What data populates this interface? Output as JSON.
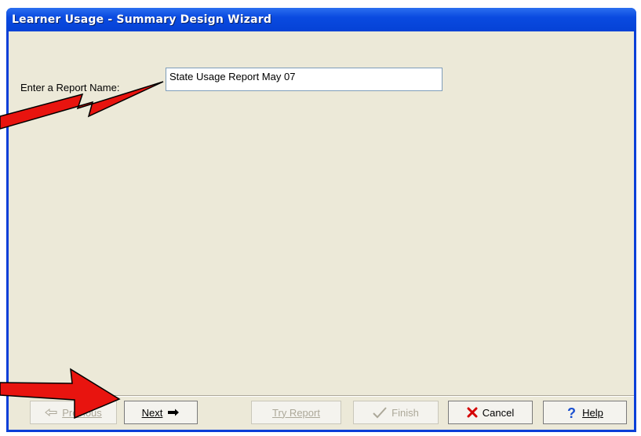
{
  "window": {
    "title": "Learner Usage - Summary Design Wizard"
  },
  "form": {
    "label": "Enter a Report Name:",
    "report_name_value": "State Usage Report May 07"
  },
  "buttons": {
    "previous": {
      "label": "Previous",
      "icon": "left-arrow-icon",
      "enabled": false
    },
    "next": {
      "label": "Next",
      "icon": "right-arrow-icon",
      "enabled": true
    },
    "try_report": {
      "label": "Try Report",
      "enabled": false
    },
    "finish": {
      "label": "Finish",
      "icon": "checkmark-icon",
      "enabled": false
    },
    "cancel": {
      "label": "Cancel",
      "icon": "red-x-icon",
      "enabled": true
    },
    "help": {
      "label": "Help",
      "icon": "question-mark-icon",
      "enabled": true
    }
  },
  "annotations": {
    "arrow_color": "#e8140f"
  },
  "colors": {
    "titlebar": "#0542d6",
    "client": "#ece9d8"
  }
}
